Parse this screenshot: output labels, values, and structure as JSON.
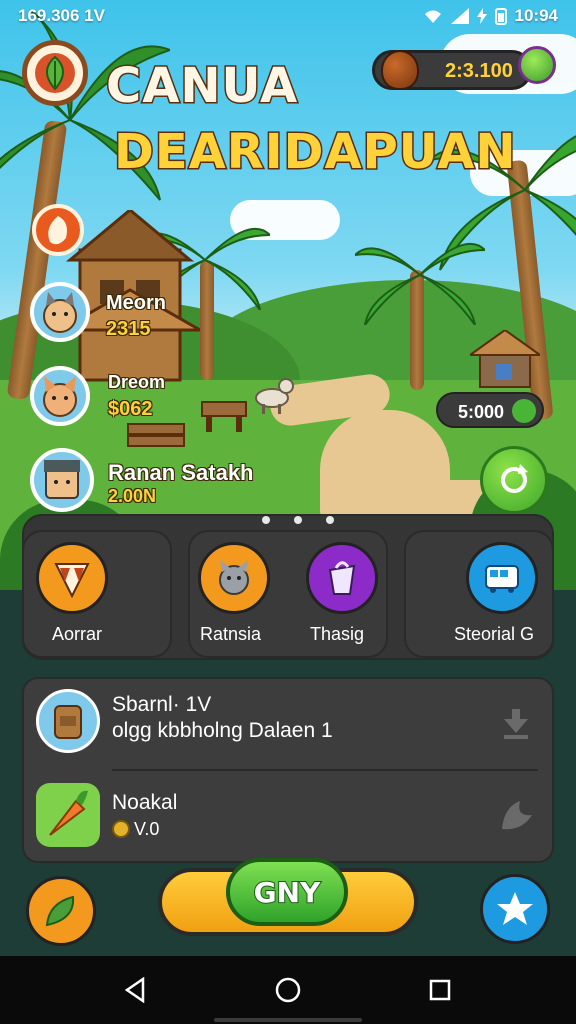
{
  "status_bar": {
    "time_left": "169.306 1V",
    "time_right": "10:94"
  },
  "header": {
    "title_line1": "CANUA",
    "title_line2": "DEARIDAPUAN"
  },
  "currency": {
    "value": "2:3.100",
    "icon": "acorn-icon",
    "badge_icon": "gem-icon"
  },
  "characters": [
    {
      "name": "",
      "value": "",
      "icon": "food-icon"
    },
    {
      "name": "Meorn",
      "value": "2315",
      "icon": "cat-face-icon"
    },
    {
      "name": "Dreom",
      "value": "$062",
      "icon": "fox-face-icon"
    },
    {
      "name": "Ranan Satakh",
      "value": "2.00N",
      "icon": "robot-face-icon"
    }
  ],
  "map_resource": {
    "value": "5:000",
    "icon": "leaf-icon"
  },
  "map_action": {
    "icon": "refresh-icon"
  },
  "carousel": {
    "page_count": 3
  },
  "categories": [
    {
      "label": "Aorrar",
      "icon": "fox-mask-icon",
      "color": "#f39a1e"
    },
    {
      "label": "Ratnsia",
      "icon": "cat-icon",
      "color": "#f39a1e"
    },
    {
      "label": "Thasig",
      "icon": "bag-icon",
      "color": "#8d2bc9"
    },
    {
      "label": "Steorial G",
      "icon": "bus-icon",
      "color": "#1e9be0"
    }
  ],
  "list": [
    {
      "title": "Sbarnl· 1V",
      "subtitle": "olgg kbbholng Dalaen 1",
      "icon": "backpack-icon",
      "action_icon": "download-icon"
    },
    {
      "title": "Noakal",
      "subtitle": "V.0",
      "icon": "carrot-icon",
      "action_icon": "leaf-action-icon"
    }
  ],
  "bottom_actions": {
    "left_icon": "bean-icon",
    "go_label": "GNY",
    "right_icon": "star-icon"
  },
  "nav": {
    "back": "back-icon",
    "home": "home-icon",
    "recents": "recents-icon"
  }
}
